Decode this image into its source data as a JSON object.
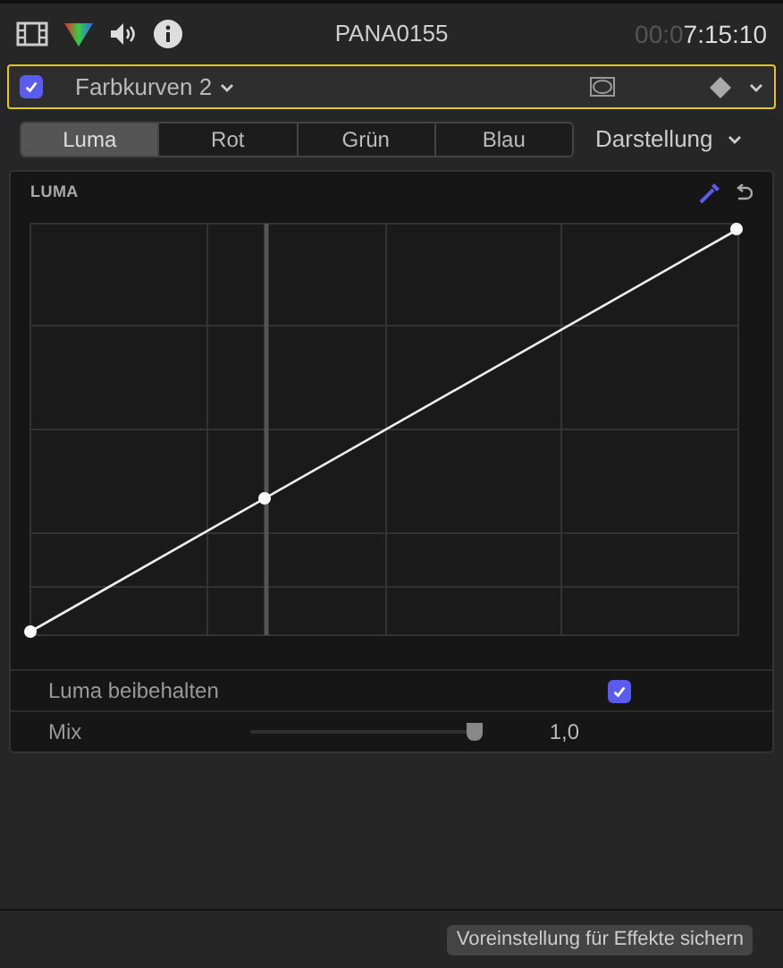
{
  "header": {
    "clip_name": "PANA0155",
    "timecode_dim": "00:0",
    "timecode": "7:15:10"
  },
  "effect": {
    "enabled": true,
    "name": "Farbkurven 2"
  },
  "tabs": [
    {
      "label": "Luma",
      "selected": true
    },
    {
      "label": "Rot",
      "selected": false
    },
    {
      "label": "Grün",
      "selected": false
    },
    {
      "label": "Blau",
      "selected": false
    }
  ],
  "view_menu": "Darstellung",
  "curve": {
    "title": "LUMA"
  },
  "rows": [
    {
      "kind": "checkbox",
      "label": "Luma beibehalten",
      "checked": true
    },
    {
      "kind": "slider",
      "label": "Mix",
      "level": 1,
      "reading": "1,0"
    }
  ],
  "save_button": "Voreinstellung für Effekte sichern"
}
